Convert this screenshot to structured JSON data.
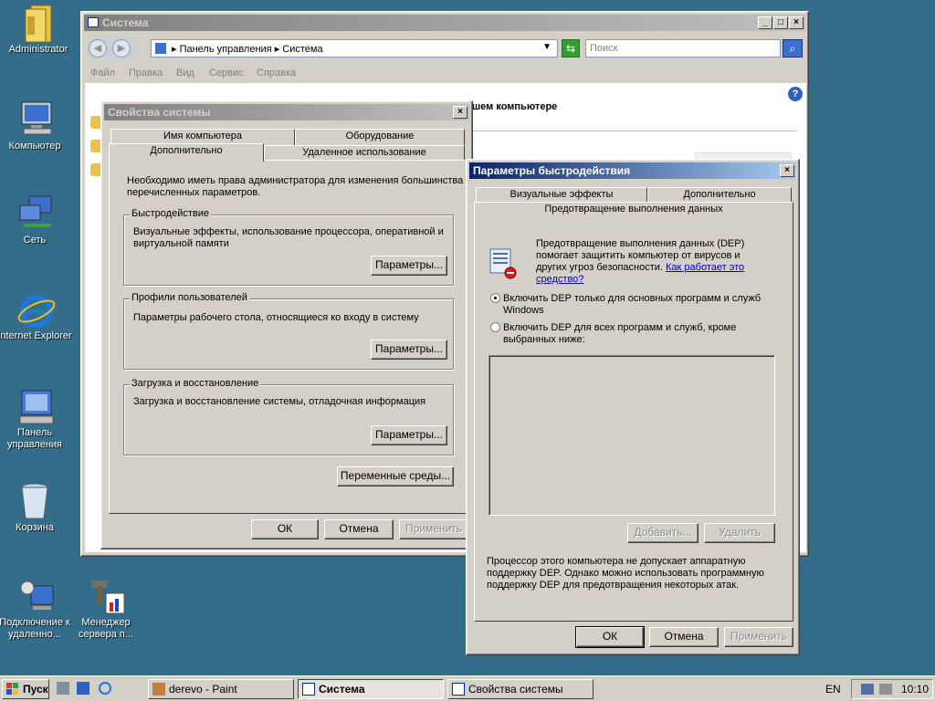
{
  "desktop": {
    "icons": [
      {
        "label": "Administrator"
      },
      {
        "label": "Компьютер"
      },
      {
        "label": "Сеть"
      },
      {
        "label": "Internet Explorer"
      },
      {
        "label": "Панель управления"
      },
      {
        "label": "Корзина"
      },
      {
        "label": "Подключение к удаленно..."
      },
      {
        "label": "Менеджер сервера п..."
      }
    ]
  },
  "system_window": {
    "title": "Система",
    "address": {
      "part1": "Панель управления",
      "part2": "Система"
    },
    "search_placeholder": "Поиск",
    "menu": [
      "Файл",
      "Правка",
      "Вид",
      "Сервис",
      "Справка"
    ],
    "partial_heading": "шем компьютере"
  },
  "props_dialog": {
    "title": "Свойства системы",
    "tabs_back": [
      "Имя компьютера",
      "Оборудование"
    ],
    "tabs_front": [
      "Дополнительно",
      "Удаленное использование"
    ],
    "intro": "Необходимо иметь права администратора для изменения большинства перечисленных параметров.",
    "groups": [
      {
        "title": "Быстродействие",
        "text": "Визуальные эффекты, использование процессора, оперативной и виртуальной памяти",
        "button": "Параметры..."
      },
      {
        "title": "Профили пользователей",
        "text": "Параметры рабочего стола, относящиеся ко входу в систему",
        "button": "Параметры..."
      },
      {
        "title": "Загрузка и восстановление",
        "text": "Загрузка и восстановление системы, отладочная информация",
        "button": "Параметры..."
      }
    ],
    "env_button": "Переменные среды...",
    "ok": "ОК",
    "cancel": "Отмена",
    "apply": "Применить"
  },
  "perf_dialog": {
    "title": "Параметры быстродействия",
    "tabs_back": [
      "Визуальные эффекты",
      "Дополнительно"
    ],
    "tab_active": "Предотвращение выполнения данных",
    "dep_desc": "Предотвращение выполнения данных (DEP) помогает защитить компьютер от вирусов и других угроз безопасности.",
    "dep_link": "Как работает это средство?",
    "radio1": "Включить DEP только для основных программ и служб Windows",
    "radio2": "Включить DEP для всех программ и служб, кроме выбранных ниже:",
    "add": "Добавить...",
    "remove": "Удалить",
    "footer": "Процессор этого компьютера не допускает аппаратную поддержку DEP. Однако можно использовать программную поддержку DEP для предотвращения некоторых атак.",
    "ok": "ОК",
    "cancel": "Отмена",
    "apply": "Применить"
  },
  "taskbar": {
    "start": "Пуск",
    "tasks": [
      "derevo - Paint",
      "Система",
      "Свойства системы"
    ],
    "lang": "EN",
    "clock": "10:10"
  }
}
